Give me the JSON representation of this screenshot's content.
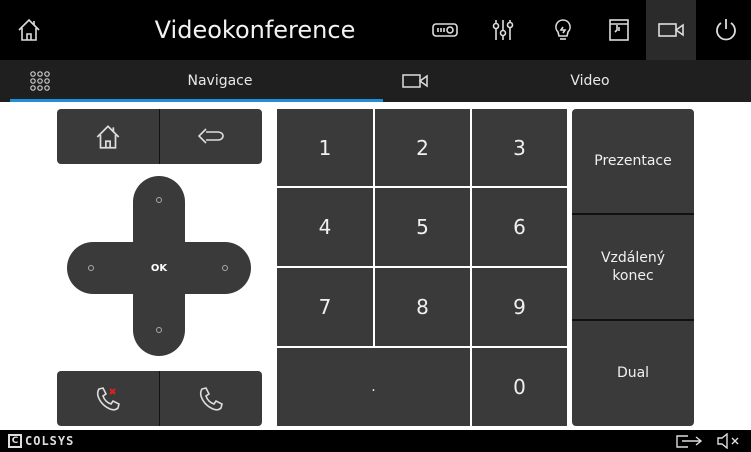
{
  "header": {
    "title": "Videokonference",
    "icons": [
      "home-icon",
      "projector-icon",
      "mixer-icon",
      "bulb-icon",
      "screen-icon",
      "camera-icon",
      "power-icon"
    ]
  },
  "tabs": {
    "menu_icon": "grid-dots-icon",
    "nav_label": "Navigace",
    "video_icon": "camera-icon",
    "video_label": "Video"
  },
  "nav": {
    "home_icon": "home-icon",
    "back_icon": "back-arrow-icon",
    "ok_label": "OK",
    "hangup_icon": "hangup-icon",
    "call_icon": "call-icon"
  },
  "keypad": {
    "keys": [
      "1",
      "2",
      "3",
      "4",
      "5",
      "6",
      "7",
      "8",
      "9",
      ".",
      "0"
    ]
  },
  "side": {
    "prezentace": "Prezentace",
    "vzdaleny": "Vzdálený konec",
    "dual": "Dual"
  },
  "footer": {
    "logo_c": "C",
    "logo_text": "COLSYS",
    "icons": [
      "exit-icon",
      "mute-icon"
    ]
  },
  "colors": {
    "accent": "#1f8fd8",
    "button": "#3a3a3a",
    "hangup": "#e02020"
  }
}
